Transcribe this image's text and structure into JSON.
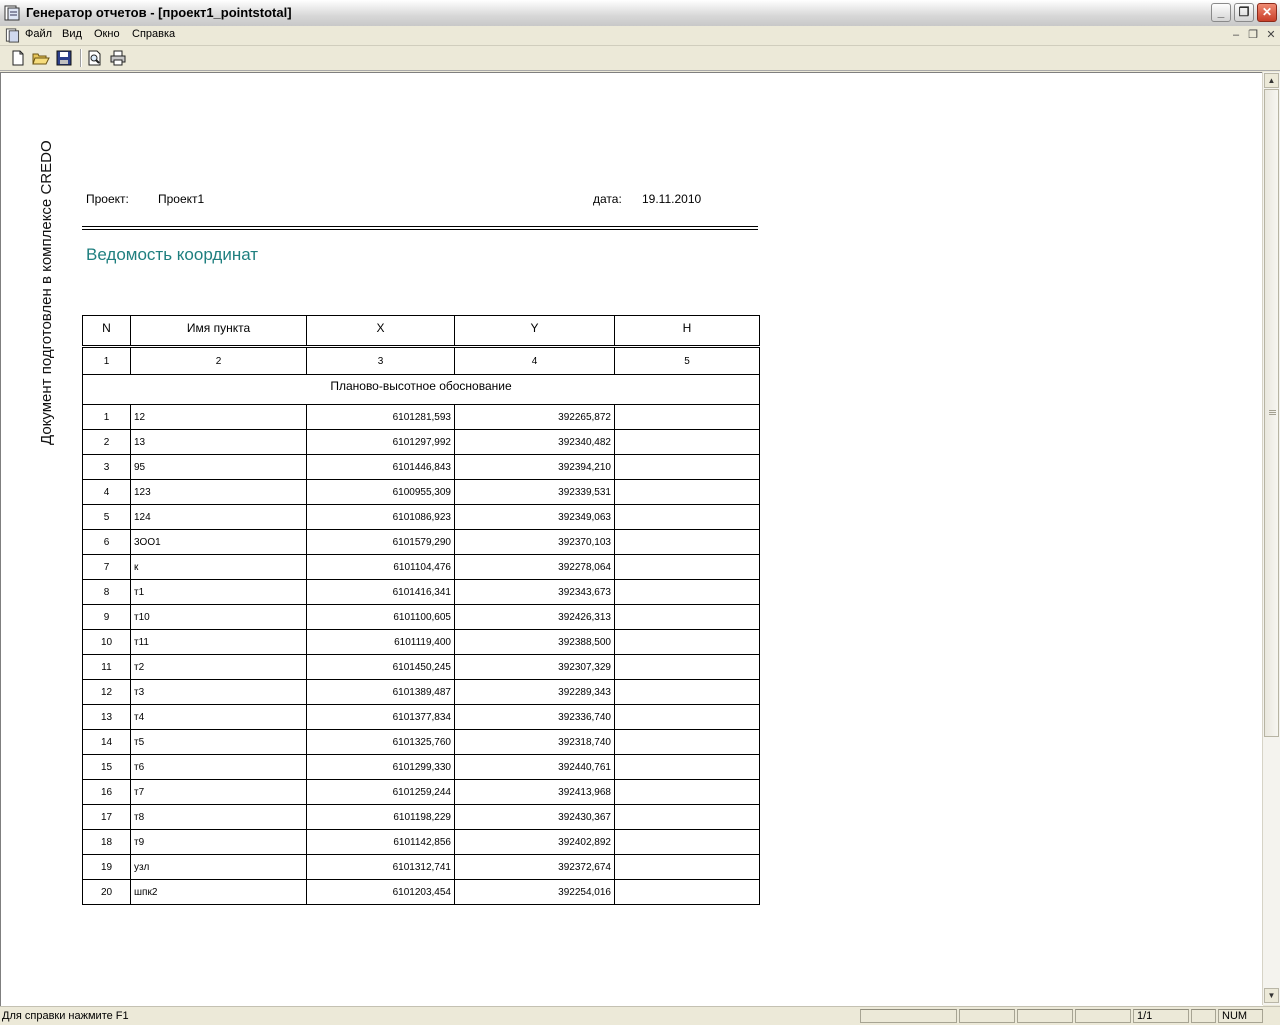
{
  "window": {
    "title": "Генератор отчетов - [проект1_pointstotal]"
  },
  "menu": {
    "items": [
      "Файл",
      "Вид",
      "Окно",
      "Справка"
    ]
  },
  "toolbar": {
    "icons": [
      "new-document-icon",
      "open-folder-icon",
      "save-icon",
      "print-preview-icon",
      "print-icon"
    ]
  },
  "document": {
    "side_text": "Документ подготовлен в комплексе CREDO",
    "project_label": "Проект:",
    "project_value": "Проект1",
    "date_label": "дата:",
    "date_value": "19.11.2010",
    "title": "Ведомость координат",
    "table": {
      "headers": [
        "N",
        "Имя пункта",
        "X",
        "Y",
        "H"
      ],
      "column_numbers": [
        "1",
        "2",
        "3",
        "4",
        "5"
      ],
      "section": "Планово-высотное обоснование",
      "rows": [
        {
          "n": "1",
          "name": "12",
          "x": "6101281,593",
          "y": "392265,872",
          "h": ""
        },
        {
          "n": "2",
          "name": "13",
          "x": "6101297,992",
          "y": "392340,482",
          "h": ""
        },
        {
          "n": "3",
          "name": "95",
          "x": "6101446,843",
          "y": "392394,210",
          "h": ""
        },
        {
          "n": "4",
          "name": "123",
          "x": "6100955,309",
          "y": "392339,531",
          "h": ""
        },
        {
          "n": "5",
          "name": "124",
          "x": "6101086,923",
          "y": "392349,063",
          "h": ""
        },
        {
          "n": "6",
          "name": "3OO1",
          "x": "6101579,290",
          "y": "392370,103",
          "h": ""
        },
        {
          "n": "7",
          "name": "к",
          "x": "6101104,476",
          "y": "392278,064",
          "h": ""
        },
        {
          "n": "8",
          "name": "т1",
          "x": "6101416,341",
          "y": "392343,673",
          "h": ""
        },
        {
          "n": "9",
          "name": "т10",
          "x": "6101100,605",
          "y": "392426,313",
          "h": ""
        },
        {
          "n": "10",
          "name": "т11",
          "x": "6101119,400",
          "y": "392388,500",
          "h": ""
        },
        {
          "n": "11",
          "name": "т2",
          "x": "6101450,245",
          "y": "392307,329",
          "h": ""
        },
        {
          "n": "12",
          "name": "т3",
          "x": "6101389,487",
          "y": "392289,343",
          "h": ""
        },
        {
          "n": "13",
          "name": "т4",
          "x": "6101377,834",
          "y": "392336,740",
          "h": ""
        },
        {
          "n": "14",
          "name": "т5",
          "x": "6101325,760",
          "y": "392318,740",
          "h": ""
        },
        {
          "n": "15",
          "name": "т6",
          "x": "6101299,330",
          "y": "392440,761",
          "h": ""
        },
        {
          "n": "16",
          "name": "т7",
          "x": "6101259,244",
          "y": "392413,968",
          "h": ""
        },
        {
          "n": "17",
          "name": "т8",
          "x": "6101198,229",
          "y": "392430,367",
          "h": ""
        },
        {
          "n": "18",
          "name": "т9",
          "x": "6101142,856",
          "y": "392402,892",
          "h": ""
        },
        {
          "n": "19",
          "name": "узл",
          "x": "6101312,741",
          "y": "392372,674",
          "h": ""
        },
        {
          "n": "20",
          "name": "шпк2",
          "x": "6101203,454",
          "y": "392254,016",
          "h": ""
        }
      ]
    }
  },
  "status": {
    "help_text": "Для справки нажмите F1",
    "page": "1/1",
    "num": "NUM"
  },
  "colors": {
    "title_accent": "#1f7f7f"
  }
}
